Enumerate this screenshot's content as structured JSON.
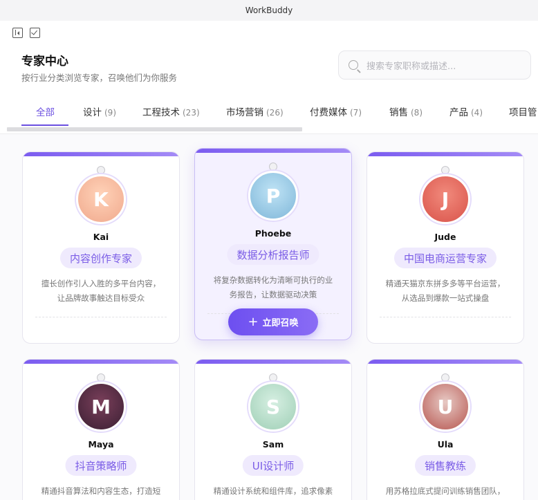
{
  "window": {
    "title": "WorkBuddy"
  },
  "header": {
    "title": "专家中心",
    "subtitle": "按行业分类浏览专家，召唤他们为你服务"
  },
  "search": {
    "placeholder": "搜索专家职称或描述..."
  },
  "tabs": [
    {
      "label": "全部",
      "count": ""
    },
    {
      "label": "设计",
      "count": "(9)"
    },
    {
      "label": "工程技术",
      "count": "(23)"
    },
    {
      "label": "市场营销",
      "count": "(26)"
    },
    {
      "label": "付费媒体",
      "count": "(7)"
    },
    {
      "label": "销售",
      "count": "(8)"
    },
    {
      "label": "产品",
      "count": "(4)"
    },
    {
      "label": "项目管",
      "count": ""
    }
  ],
  "active_tab": "全部",
  "colors": {
    "accent": "#6b4fe0",
    "pill_bg": "#efeafd",
    "pill_text": "#7a5ce6"
  },
  "experts": [
    {
      "name": "Kai",
      "role": "内容创作专家",
      "desc": [
        "擅长创作引人入胜的多平台内容，",
        "让品牌故事触达目标受众"
      ],
      "avatar_icon": "creator-avatar"
    },
    {
      "name": "Phoebe",
      "role": "数据分析报告师",
      "desc": [
        "将复杂数据转化为清晰可执行的业",
        "务报告，让数据驱动决策"
      ],
      "avatar_icon": "analyst-avatar",
      "action": "立即召唤"
    },
    {
      "name": "Jude",
      "role": "中国电商运营专家",
      "desc": [
        "精通天猫京东拼多多等平台运营，",
        "从选品到爆款一站式操盘"
      ],
      "avatar_icon": "ecommerce-avatar"
    },
    {
      "name": "Maya",
      "role": "抖音策略师",
      "desc": [
        "精通抖音算法和内容生态，打造短"
      ],
      "avatar_icon": "douyin-avatar"
    },
    {
      "name": "Sam",
      "role": "UI设计师",
      "desc": [
        "精通设计系统和组件库，追求像素"
      ],
      "avatar_icon": "designer-avatar"
    },
    {
      "name": "Ula",
      "role": "销售教练",
      "desc": [
        "用苏格拉底式提问训练销售团队，"
      ],
      "avatar_icon": "coach-avatar"
    }
  ]
}
